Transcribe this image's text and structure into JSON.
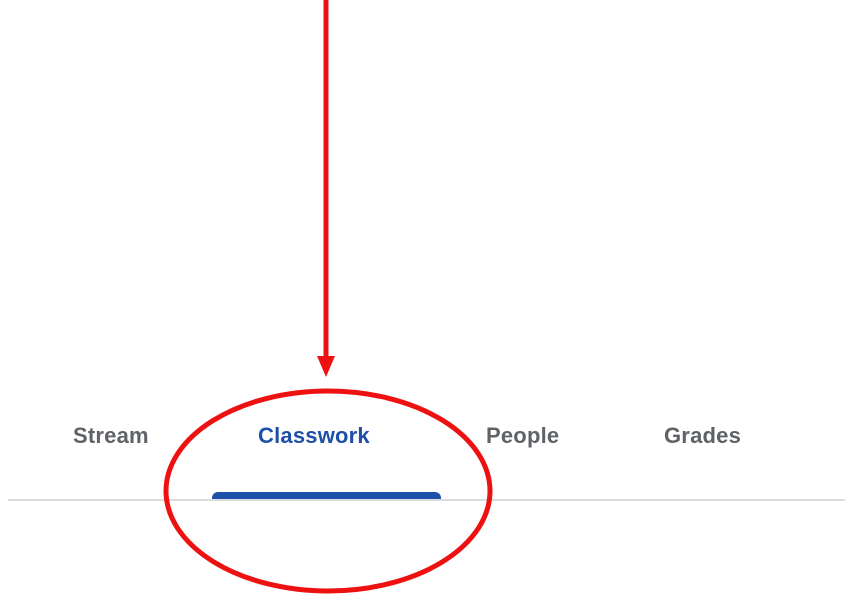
{
  "tabs": {
    "stream": "Stream",
    "classwork": "Classwork",
    "people": "People",
    "grades": "Grades",
    "active": "classwork"
  },
  "colors": {
    "active_tab": "#1e50a8",
    "inactive_tab": "#5f6368",
    "divider": "#dadce0",
    "annotation": "#ee1111"
  },
  "annotation": {
    "arrow": "down-arrow",
    "highlight": "ellipse-around-classwork-tab"
  }
}
